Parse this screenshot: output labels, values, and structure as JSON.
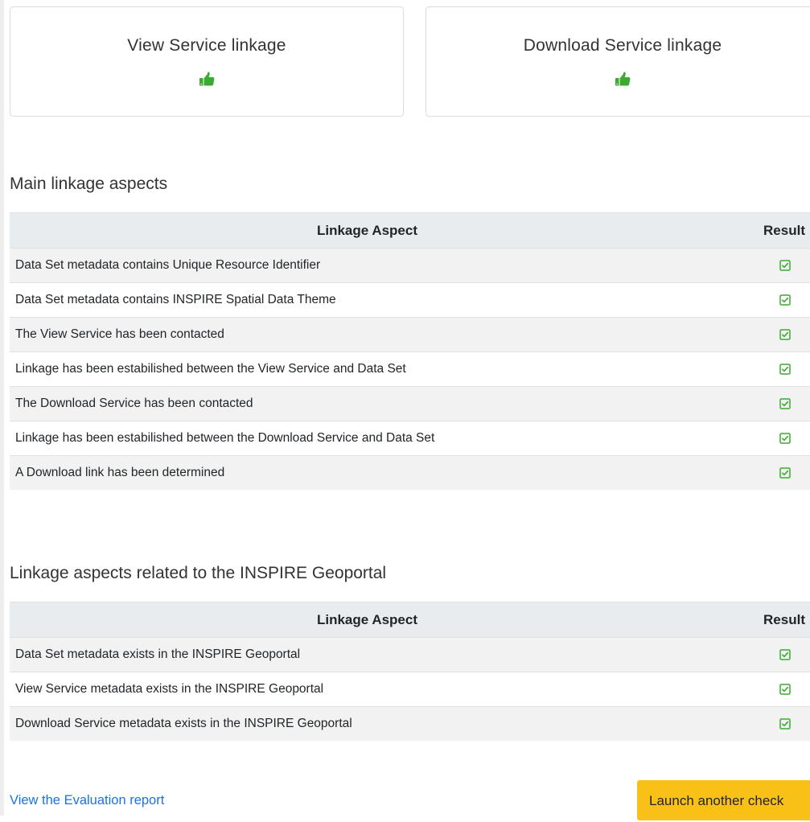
{
  "cards": [
    {
      "title": "View Service linkage",
      "icon": "thumbs-up-icon",
      "color": "#3bab2f"
    },
    {
      "title": "Download Service linkage",
      "icon": "thumbs-up-icon",
      "color": "#3bab2f"
    }
  ],
  "main_section": {
    "title": "Main linkage aspects",
    "header": {
      "aspect": "Linkage Aspect",
      "result": "Result"
    },
    "rows": [
      {
        "aspect": "Data Set metadata contains Unique Resource Identifier",
        "result_icon": "check-square-icon"
      },
      {
        "aspect": "Data Set metadata contains INSPIRE Spatial Data Theme",
        "result_icon": "check-square-icon"
      },
      {
        "aspect": "The View Service has been contacted",
        "result_icon": "check-square-icon"
      },
      {
        "aspect": "Linkage has been estabilished between the View Service and Data Set",
        "result_icon": "check-square-icon"
      },
      {
        "aspect": "The Download Service has been contacted",
        "result_icon": "check-square-icon"
      },
      {
        "aspect": "Linkage has been estabilished between the Download Service and Data Set",
        "result_icon": "check-square-icon"
      },
      {
        "aspect": "A Download link has been determined",
        "result_icon": "check-square-icon"
      }
    ]
  },
  "geoportal_section": {
    "title": "Linkage aspects related to the INSPIRE Geoportal",
    "header": {
      "aspect": "Linkage Aspect",
      "result": "Result"
    },
    "rows": [
      {
        "aspect": "Data Set metadata exists in the INSPIRE Geoportal",
        "result_icon": "check-square-icon"
      },
      {
        "aspect": "View Service metadata exists in the INSPIRE Geoportal",
        "result_icon": "check-square-icon"
      },
      {
        "aspect": "Download Service metadata exists in the INSPIRE Geoportal",
        "result_icon": "check-square-icon"
      }
    ]
  },
  "footer": {
    "report_link": "View the Evaluation report",
    "launch_button": "Launch another check"
  },
  "colors": {
    "success": "#3bab2f",
    "link": "#1a73e8",
    "button": "#f9c017",
    "header_bg": "#e9ecef",
    "stripe_bg": "#f2f2f2"
  }
}
